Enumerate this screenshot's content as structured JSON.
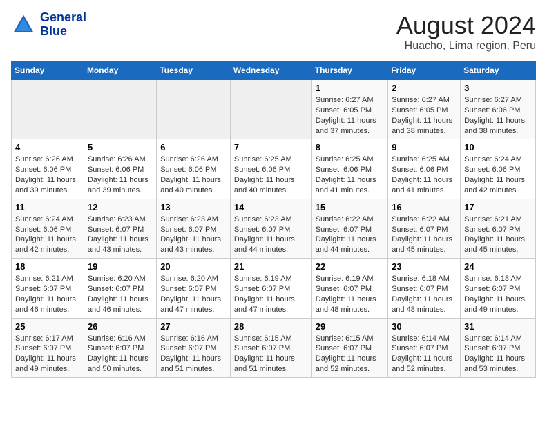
{
  "header": {
    "logo_line1": "General",
    "logo_line2": "Blue",
    "title": "August 2024",
    "subtitle": "Huacho, Lima region, Peru"
  },
  "calendar": {
    "days_of_week": [
      "Sunday",
      "Monday",
      "Tuesday",
      "Wednesday",
      "Thursday",
      "Friday",
      "Saturday"
    ],
    "weeks": [
      [
        {
          "day": "",
          "content": ""
        },
        {
          "day": "",
          "content": ""
        },
        {
          "day": "",
          "content": ""
        },
        {
          "day": "",
          "content": ""
        },
        {
          "day": "1",
          "content": "Sunrise: 6:27 AM\nSunset: 6:05 PM\nDaylight: 11 hours and 37 minutes."
        },
        {
          "day": "2",
          "content": "Sunrise: 6:27 AM\nSunset: 6:05 PM\nDaylight: 11 hours and 38 minutes."
        },
        {
          "day": "3",
          "content": "Sunrise: 6:27 AM\nSunset: 6:06 PM\nDaylight: 11 hours and 38 minutes."
        }
      ],
      [
        {
          "day": "4",
          "content": "Sunrise: 6:26 AM\nSunset: 6:06 PM\nDaylight: 11 hours and 39 minutes."
        },
        {
          "day": "5",
          "content": "Sunrise: 6:26 AM\nSunset: 6:06 PM\nDaylight: 11 hours and 39 minutes."
        },
        {
          "day": "6",
          "content": "Sunrise: 6:26 AM\nSunset: 6:06 PM\nDaylight: 11 hours and 40 minutes."
        },
        {
          "day": "7",
          "content": "Sunrise: 6:25 AM\nSunset: 6:06 PM\nDaylight: 11 hours and 40 minutes."
        },
        {
          "day": "8",
          "content": "Sunrise: 6:25 AM\nSunset: 6:06 PM\nDaylight: 11 hours and 41 minutes."
        },
        {
          "day": "9",
          "content": "Sunrise: 6:25 AM\nSunset: 6:06 PM\nDaylight: 11 hours and 41 minutes."
        },
        {
          "day": "10",
          "content": "Sunrise: 6:24 AM\nSunset: 6:06 PM\nDaylight: 11 hours and 42 minutes."
        }
      ],
      [
        {
          "day": "11",
          "content": "Sunrise: 6:24 AM\nSunset: 6:06 PM\nDaylight: 11 hours and 42 minutes."
        },
        {
          "day": "12",
          "content": "Sunrise: 6:23 AM\nSunset: 6:07 PM\nDaylight: 11 hours and 43 minutes."
        },
        {
          "day": "13",
          "content": "Sunrise: 6:23 AM\nSunset: 6:07 PM\nDaylight: 11 hours and 43 minutes."
        },
        {
          "day": "14",
          "content": "Sunrise: 6:23 AM\nSunset: 6:07 PM\nDaylight: 11 hours and 44 minutes."
        },
        {
          "day": "15",
          "content": "Sunrise: 6:22 AM\nSunset: 6:07 PM\nDaylight: 11 hours and 44 minutes."
        },
        {
          "day": "16",
          "content": "Sunrise: 6:22 AM\nSunset: 6:07 PM\nDaylight: 11 hours and 45 minutes."
        },
        {
          "day": "17",
          "content": "Sunrise: 6:21 AM\nSunset: 6:07 PM\nDaylight: 11 hours and 45 minutes."
        }
      ],
      [
        {
          "day": "18",
          "content": "Sunrise: 6:21 AM\nSunset: 6:07 PM\nDaylight: 11 hours and 46 minutes."
        },
        {
          "day": "19",
          "content": "Sunrise: 6:20 AM\nSunset: 6:07 PM\nDaylight: 11 hours and 46 minutes."
        },
        {
          "day": "20",
          "content": "Sunrise: 6:20 AM\nSunset: 6:07 PM\nDaylight: 11 hours and 47 minutes."
        },
        {
          "day": "21",
          "content": "Sunrise: 6:19 AM\nSunset: 6:07 PM\nDaylight: 11 hours and 47 minutes."
        },
        {
          "day": "22",
          "content": "Sunrise: 6:19 AM\nSunset: 6:07 PM\nDaylight: 11 hours and 48 minutes."
        },
        {
          "day": "23",
          "content": "Sunrise: 6:18 AM\nSunset: 6:07 PM\nDaylight: 11 hours and 48 minutes."
        },
        {
          "day": "24",
          "content": "Sunrise: 6:18 AM\nSunset: 6:07 PM\nDaylight: 11 hours and 49 minutes."
        }
      ],
      [
        {
          "day": "25",
          "content": "Sunrise: 6:17 AM\nSunset: 6:07 PM\nDaylight: 11 hours and 49 minutes."
        },
        {
          "day": "26",
          "content": "Sunrise: 6:16 AM\nSunset: 6:07 PM\nDaylight: 11 hours and 50 minutes."
        },
        {
          "day": "27",
          "content": "Sunrise: 6:16 AM\nSunset: 6:07 PM\nDaylight: 11 hours and 51 minutes."
        },
        {
          "day": "28",
          "content": "Sunrise: 6:15 AM\nSunset: 6:07 PM\nDaylight: 11 hours and 51 minutes."
        },
        {
          "day": "29",
          "content": "Sunrise: 6:15 AM\nSunset: 6:07 PM\nDaylight: 11 hours and 52 minutes."
        },
        {
          "day": "30",
          "content": "Sunrise: 6:14 AM\nSunset: 6:07 PM\nDaylight: 11 hours and 52 minutes."
        },
        {
          "day": "31",
          "content": "Sunrise: 6:14 AM\nSunset: 6:07 PM\nDaylight: 11 hours and 53 minutes."
        }
      ]
    ]
  }
}
